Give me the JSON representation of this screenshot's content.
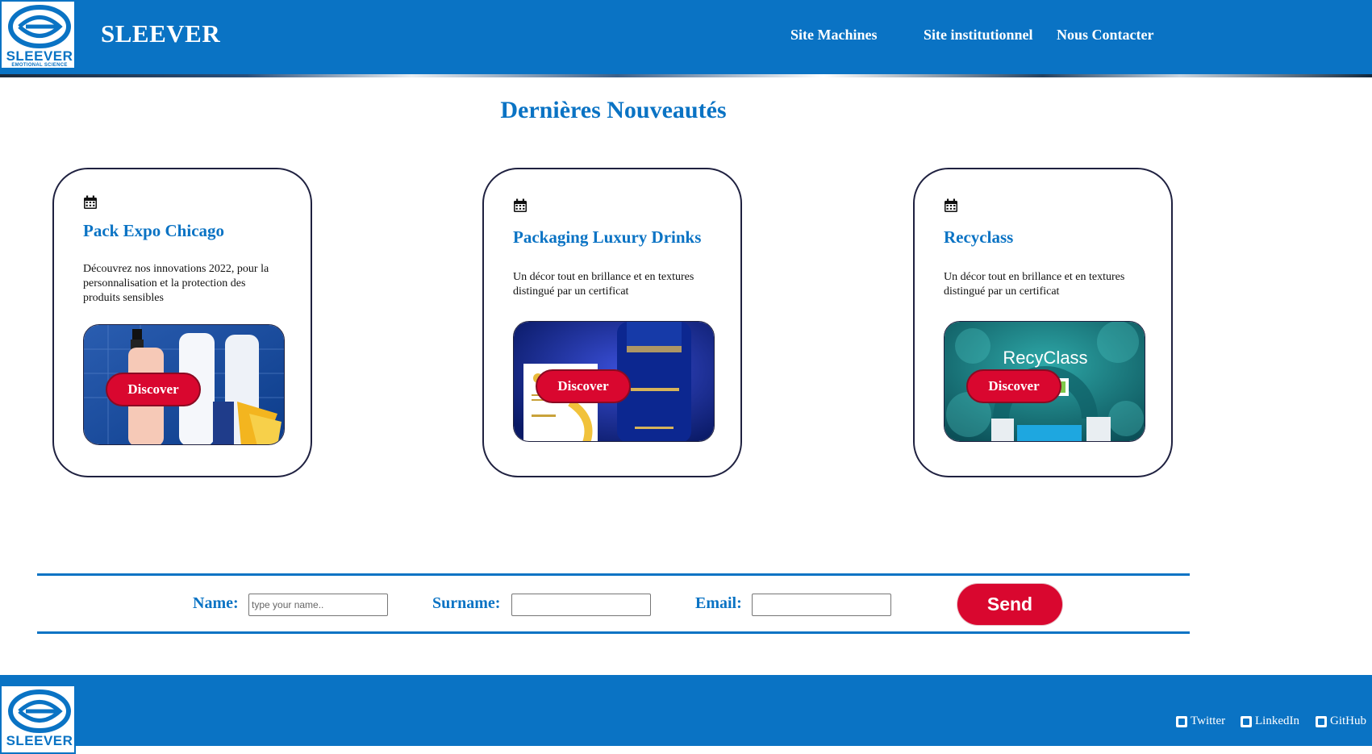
{
  "colors": {
    "brand_blue": "#0a73c4",
    "accent_red": "#d9072f",
    "card_border": "#1f2140"
  },
  "header": {
    "logo_text": "SLEEVER",
    "logo_tagline": "EMOTIONAL SCIENCE",
    "brand": "SLEEVER",
    "nav": [
      {
        "label": "Site Machines"
      },
      {
        "label": "Site institutionnel"
      },
      {
        "label": "Nous Contacter"
      }
    ]
  },
  "main": {
    "title": "Dernières Nouveautés",
    "cards": [
      {
        "icon": "calendar-icon",
        "title": "Pack Expo Chicago",
        "description": "Découvrez nos innovations 2022, pour la personnalisation et la protection des produits sensibles",
        "button_label": "Discover"
      },
      {
        "icon": "calendar-icon",
        "title": "Packaging Luxury Drinks",
        "description": "Un décor tout en brillance et en textures distingué par un certificat",
        "button_label": "Discover"
      },
      {
        "icon": "calendar-icon",
        "title": "Recyclass",
        "description": "Un décor tout en brillance et en textures distingué par un certificat",
        "button_label": "Discover",
        "image_text": "RecyClass"
      }
    ]
  },
  "form": {
    "name_label": "Name:",
    "name_placeholder": "type your name..",
    "surname_label": "Surname:",
    "email_label": "Email:",
    "send_label": "Send"
  },
  "footer": {
    "logo_text": "SLEEVER",
    "links": [
      {
        "icon": "twitter-icon",
        "label": "Twitter"
      },
      {
        "icon": "linkedin-icon",
        "label": "LinkedIn"
      },
      {
        "icon": "github-icon",
        "label": "GitHub"
      }
    ]
  }
}
